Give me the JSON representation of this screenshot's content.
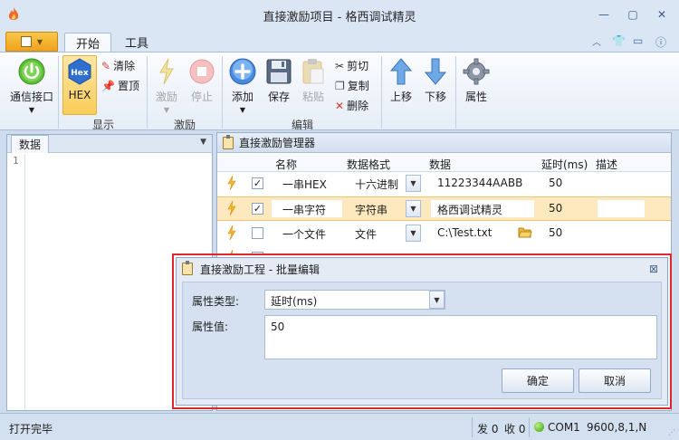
{
  "window": {
    "title": "直接激励项目 - 格西调试精灵"
  },
  "ribbon": {
    "tabs": [
      "开始",
      "工具"
    ],
    "buttons": {
      "connect": "通信接口",
      "hex": "HEX",
      "clear": "清除",
      "top": "置顶",
      "stimulate": "激励",
      "stop": "停止",
      "add": "添加",
      "save": "保存",
      "paste": "粘贴",
      "cut": "剪切",
      "copy": "复制",
      "delete": "删除",
      "move_up": "上移",
      "move_down": "下移",
      "properties": "属性"
    },
    "groups": {
      "display": "显示",
      "stimulate": "激励",
      "edit": "编辑"
    }
  },
  "left_panel": {
    "tab": "数据",
    "line_number": "1"
  },
  "manager": {
    "title": "直接激励管理器",
    "columns": [
      "名称",
      "数据格式",
      "数据",
      "延时(ms)",
      "描述"
    ],
    "rows": [
      {
        "checked": true,
        "name": "一串HEX",
        "format": "十六进制",
        "data": "11223344AABB",
        "delay": "50",
        "desc": ""
      },
      {
        "checked": true,
        "name": "一串字符",
        "format": "字符串",
        "data": "格西调试精灵",
        "delay": "50",
        "desc": ""
      },
      {
        "checked": false,
        "name": "一个文件",
        "format": "文件",
        "data": "C:\\Test.txt",
        "delay": "50",
        "desc": ""
      }
    ]
  },
  "dialog": {
    "title": "直接激励工程 - 批量编辑",
    "property_type_label": "属性类型:",
    "property_type_value": "延时(ms)",
    "property_value_label": "属性值:",
    "property_value": "50",
    "ok": "确定",
    "cancel": "取消"
  },
  "status": {
    "message": "打开完毕",
    "sent": "发 0",
    "received": "收 0",
    "port": "COM1",
    "settings": "9600,8,1,N"
  },
  "colors": {
    "accent_orange": "#f0a21c",
    "selected_row": "#fde9bd",
    "highlight_border": "#e0262a",
    "connect_green": "#3b9b1c"
  }
}
